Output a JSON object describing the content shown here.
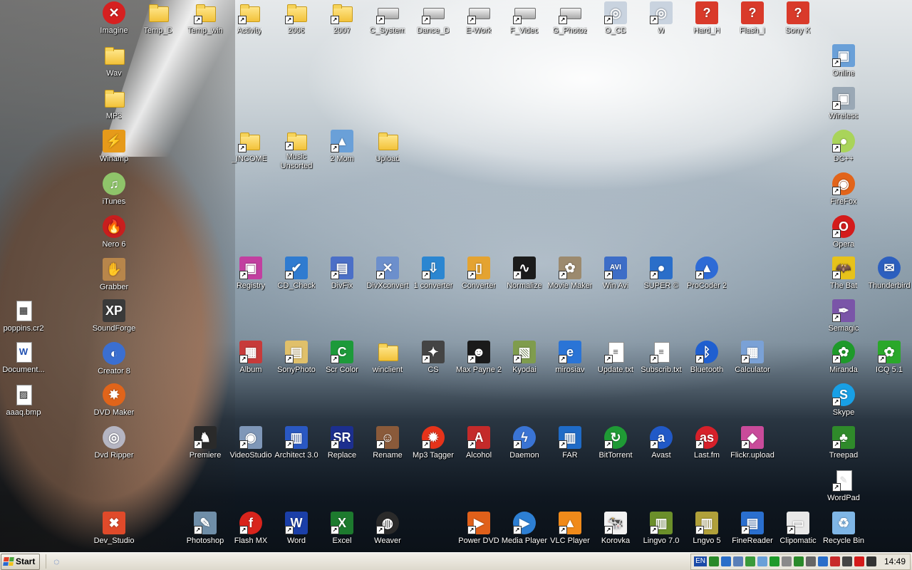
{
  "desktop": {
    "icons": [
      {
        "label": "Imagine",
        "glyph": "✕",
        "color": "#d62020",
        "kind": "circle",
        "shortcut": false
      },
      {
        "label": "Temp_D",
        "glyph": "",
        "color": "#f2c23a",
        "kind": "folder",
        "shortcut": false
      },
      {
        "label": "Temp_win",
        "glyph": "",
        "color": "#f2c23a",
        "kind": "folder",
        "shortcut": true
      },
      {
        "label": "Activity",
        "glyph": "",
        "color": "#f2c23a",
        "kind": "folder",
        "shortcut": true
      },
      {
        "label": "2006",
        "glyph": "",
        "color": "#f2c23a",
        "kind": "folder",
        "shortcut": true
      },
      {
        "label": "2007",
        "glyph": "",
        "color": "#f2c23a",
        "kind": "folder",
        "shortcut": true
      },
      {
        "label": "C_System",
        "glyph": "",
        "color": "#a9a9a9",
        "kind": "drive",
        "shortcut": true
      },
      {
        "label": "Dance_D",
        "glyph": "",
        "color": "#a9a9a9",
        "kind": "drive",
        "shortcut": true
      },
      {
        "label": "E-Work",
        "glyph": "",
        "color": "#a9a9a9",
        "kind": "drive",
        "shortcut": true
      },
      {
        "label": "F_Video",
        "glyph": "",
        "color": "#a9a9a9",
        "kind": "drive",
        "shortcut": true
      },
      {
        "label": "G_Photoz",
        "glyph": "",
        "color": "#a9a9a9",
        "kind": "drive",
        "shortcut": true
      },
      {
        "label": "O_CD",
        "glyph": "◎",
        "color": "#c9d3df",
        "kind": "box",
        "shortcut": true
      },
      {
        "label": "W",
        "glyph": "◎",
        "color": "#c9d3df",
        "kind": "box",
        "shortcut": true
      },
      {
        "label": "Hard_H",
        "glyph": "?",
        "color": "#d93a2a",
        "kind": "box",
        "shortcut": false
      },
      {
        "label": "Flash_I",
        "glyph": "?",
        "color": "#d93a2a",
        "kind": "box",
        "shortcut": false
      },
      {
        "label": "Sony K",
        "glyph": "?",
        "color": "#d93a2a",
        "kind": "box",
        "shortcut": false
      },
      {
        "label": "Wav",
        "glyph": "",
        "color": "#f2c23a",
        "kind": "folder",
        "shortcut": false
      },
      {
        "label": "MP3",
        "glyph": "",
        "color": "#f2c23a",
        "kind": "folder",
        "shortcut": false
      },
      {
        "label": "Winamp",
        "glyph": "⚡",
        "color": "#e69a1a",
        "kind": "box",
        "shortcut": false
      },
      {
        "label": "iTunes",
        "glyph": "♫",
        "color": "#8fc46a",
        "kind": "circle",
        "shortcut": false
      },
      {
        "label": "Nero 6",
        "glyph": "🔥",
        "color": "#c81e1e",
        "kind": "circle",
        "shortcut": false
      },
      {
        "label": "Grabber",
        "glyph": "✋",
        "color": "#b8864b",
        "kind": "box",
        "shortcut": false
      },
      {
        "label": "SoundForge",
        "glyph": "XP",
        "color": "#3a3a3a",
        "kind": "box",
        "shortcut": false
      },
      {
        "label": "Creator 8",
        "glyph": "◐",
        "color": "#3b6fd1",
        "kind": "circle",
        "shortcut": false
      },
      {
        "label": "DVD Maker",
        "glyph": "✸",
        "color": "#e0641a",
        "kind": "circle",
        "shortcut": false
      },
      {
        "label": "Dvd Ripper",
        "glyph": "◎",
        "color": "#b5b5c2",
        "kind": "circle",
        "shortcut": false
      },
      {
        "label": "Dev_Studio",
        "glyph": "✖",
        "color": "#e04a2a",
        "kind": "box",
        "shortcut": false
      },
      {
        "label": "poppins.cr2",
        "glyph": "▦",
        "color": "#ffffff",
        "kind": "doc",
        "shortcut": false
      },
      {
        "label": "Document...",
        "glyph": "W",
        "color": "#1f4fb0",
        "kind": "doc",
        "shortcut": false
      },
      {
        "label": "aaaq.bmp",
        "glyph": "▨",
        "color": "#ffffff",
        "kind": "doc",
        "shortcut": false
      },
      {
        "label": "_INCOME",
        "glyph": "",
        "color": "#f2c23a",
        "kind": "folder",
        "shortcut": true
      },
      {
        "label": "Music Unsorted",
        "glyph": "",
        "color": "#f2c23a",
        "kind": "folder",
        "shortcut": true
      },
      {
        "label": "2 Mom",
        "glyph": "▲",
        "color": "#6aa0d8",
        "kind": "box",
        "shortcut": true
      },
      {
        "label": "Upload",
        "glyph": "",
        "color": "#f2c23a",
        "kind": "folder",
        "shortcut": false
      },
      {
        "label": "Registry",
        "glyph": "▣",
        "color": "#c23fa0",
        "kind": "box",
        "shortcut": true
      },
      {
        "label": "CD_Check",
        "glyph": "✔",
        "color": "#2f7bd0",
        "kind": "box",
        "shortcut": true
      },
      {
        "label": "DivFix",
        "glyph": "▤",
        "color": "#4b6fc7",
        "kind": "box",
        "shortcut": true
      },
      {
        "label": "DivXconvert",
        "glyph": "✕",
        "color": "#6c8fcc",
        "kind": "box",
        "shortcut": true
      },
      {
        "label": "1 converter",
        "glyph": "⇩",
        "color": "#2b86d1",
        "kind": "box",
        "shortcut": true
      },
      {
        "label": "Converter",
        "glyph": "▯",
        "color": "#e4a331",
        "kind": "box",
        "shortcut": true
      },
      {
        "label": "Normalize",
        "glyph": "∿",
        "color": "#1b1b1b",
        "kind": "box",
        "shortcut": true
      },
      {
        "label": "Movie Maker",
        "glyph": "✿",
        "color": "#9c8a6e",
        "kind": "box",
        "shortcut": true
      },
      {
        "label": "Win Avi",
        "glyph": "AVI",
        "color": "#3d6dc7",
        "kind": "box",
        "shortcut": true
      },
      {
        "label": "SUPER ©",
        "glyph": "●",
        "color": "#2a6ec9",
        "kind": "box",
        "shortcut": true
      },
      {
        "label": "ProCoder 2",
        "glyph": "▲",
        "color": "#2e6bd6",
        "kind": "circle",
        "shortcut": true
      },
      {
        "label": "Album",
        "glyph": "▦",
        "color": "#c73a3a",
        "kind": "box",
        "shortcut": true
      },
      {
        "label": "SonyPhoto",
        "glyph": "▤",
        "color": "#e0c06a",
        "kind": "box",
        "shortcut": true
      },
      {
        "label": "Scr Color",
        "glyph": "C",
        "color": "#1d9a3a",
        "kind": "box",
        "shortcut": true
      },
      {
        "label": "winclient",
        "glyph": "",
        "color": "#f2c23a",
        "kind": "folder",
        "shortcut": false
      },
      {
        "label": "CS",
        "glyph": "✦",
        "color": "#444",
        "kind": "box",
        "shortcut": true
      },
      {
        "label": "Max Payne 2",
        "glyph": "☻",
        "color": "#1a1a1a",
        "kind": "box",
        "shortcut": true
      },
      {
        "label": "Kyodai",
        "glyph": "▧",
        "color": "#7f9c4d",
        "kind": "box",
        "shortcut": true
      },
      {
        "label": "mirosiav",
        "glyph": "e",
        "color": "#2a74d6",
        "kind": "box",
        "shortcut": true
      },
      {
        "label": "Update.txt",
        "glyph": "≡",
        "color": "#ffffff",
        "kind": "doc",
        "shortcut": true
      },
      {
        "label": "Subscrib.txt",
        "glyph": "≡",
        "color": "#ffffff",
        "kind": "doc",
        "shortcut": true
      },
      {
        "label": "Bluetooth",
        "glyph": "ᛒ",
        "color": "#1f5fd0",
        "kind": "circle",
        "shortcut": true
      },
      {
        "label": "Calculator",
        "glyph": "▦",
        "color": "#7aa1d6",
        "kind": "box",
        "shortcut": true
      },
      {
        "label": "Premiere",
        "glyph": "♞",
        "color": "#2a2a2a",
        "kind": "box",
        "shortcut": true
      },
      {
        "label": "VideoStudio",
        "glyph": "◉",
        "color": "#7f97b8",
        "kind": "box",
        "shortcut": true
      },
      {
        "label": "Architect 3.0",
        "glyph": "▥",
        "color": "#2a58c2",
        "kind": "box",
        "shortcut": true
      },
      {
        "label": "Replace",
        "glyph": "SR",
        "color": "#1c2f8f",
        "kind": "box",
        "shortcut": true
      },
      {
        "label": "Rename",
        "glyph": "☺",
        "color": "#8a5a3a",
        "kind": "box",
        "shortcut": true
      },
      {
        "label": "Mp3 Tagger",
        "glyph": "✹",
        "color": "#e6331a",
        "kind": "circle",
        "shortcut": true
      },
      {
        "label": "Alcohol",
        "glyph": "A",
        "color": "#c42a2a",
        "kind": "box",
        "shortcut": true
      },
      {
        "label": "Daemon",
        "glyph": "ϟ",
        "color": "#3a74d4",
        "kind": "circle",
        "shortcut": true
      },
      {
        "label": "FAR",
        "glyph": "▥",
        "color": "#1f6bc7",
        "kind": "box",
        "shortcut": true
      },
      {
        "label": "BitTorrent",
        "glyph": "↻",
        "color": "#1f9a35",
        "kind": "circle",
        "shortcut": true
      },
      {
        "label": "Avast",
        "glyph": "a",
        "color": "#2159c7",
        "kind": "circle",
        "shortcut": true
      },
      {
        "label": "Last.fm",
        "glyph": "as",
        "color": "#d6202a",
        "kind": "circle",
        "shortcut": true
      },
      {
        "label": "Flickr.upload",
        "glyph": "◆",
        "color": "#c94b9a",
        "kind": "box",
        "shortcut": true
      },
      {
        "label": "Photoshop",
        "glyph": "✎",
        "color": "#6f8ea8",
        "kind": "box",
        "shortcut": true
      },
      {
        "label": "Flash MX",
        "glyph": "f",
        "color": "#d8241c",
        "kind": "circle",
        "shortcut": true
      },
      {
        "label": "Word",
        "glyph": "W",
        "color": "#1b3fa8",
        "kind": "box",
        "shortcut": true
      },
      {
        "label": "Excel",
        "glyph": "X",
        "color": "#1d7a2e",
        "kind": "box",
        "shortcut": true
      },
      {
        "label": "Weaver",
        "glyph": "◍",
        "color": "#2a2a2a",
        "kind": "circle",
        "shortcut": true
      },
      {
        "label": "Power DVD",
        "glyph": "▶",
        "color": "#e0601a",
        "kind": "box",
        "shortcut": true
      },
      {
        "label": "Media Player",
        "glyph": "▶",
        "color": "#2d7fd3",
        "kind": "circle",
        "shortcut": true
      },
      {
        "label": "VLC Player",
        "glyph": "▲",
        "color": "#f08a1a",
        "kind": "box",
        "shortcut": true
      },
      {
        "label": "Korovka",
        "glyph": "🐄",
        "color": "#f2f2f2",
        "kind": "box",
        "shortcut": true
      },
      {
        "label": "Lingvo 7.0",
        "glyph": "▥",
        "color": "#6b8f2a",
        "kind": "box",
        "shortcut": true
      },
      {
        "label": "Lngvo 5",
        "glyph": "▥",
        "color": "#b0a03a",
        "kind": "box",
        "shortcut": true
      },
      {
        "label": "FineReader",
        "glyph": "▤",
        "color": "#2a6fcf",
        "kind": "box",
        "shortcut": true
      },
      {
        "label": "Clipomatic",
        "glyph": "▭",
        "color": "#e8e8e8",
        "kind": "box",
        "shortcut": true
      },
      {
        "label": "Recycle Bin",
        "glyph": "♻",
        "color": "#7fb6e6",
        "kind": "box",
        "shortcut": false
      },
      {
        "label": "Online",
        "glyph": "▣",
        "color": "#6aa0d8",
        "kind": "box",
        "shortcut": true
      },
      {
        "label": "Wireless",
        "glyph": "▣",
        "color": "#9aa8b5",
        "kind": "box",
        "shortcut": true
      },
      {
        "label": "DC++",
        "glyph": "●",
        "color": "#a9d45a",
        "kind": "circle",
        "shortcut": true
      },
      {
        "label": "FireFox",
        "glyph": "◉",
        "color": "#e2641a",
        "kind": "circle",
        "shortcut": true
      },
      {
        "label": "Opera",
        "glyph": "O",
        "color": "#d41b1b",
        "kind": "circle",
        "shortcut": true
      },
      {
        "label": "The Bat",
        "glyph": "🦇",
        "color": "#e7c21a",
        "kind": "box",
        "shortcut": true
      },
      {
        "label": "Thunderbird",
        "glyph": "✉",
        "color": "#2c5fbf",
        "kind": "circle",
        "shortcut": false
      },
      {
        "label": "Semagic",
        "glyph": "✒",
        "color": "#7a55a8",
        "kind": "box",
        "shortcut": true
      },
      {
        "label": "Miranda",
        "glyph": "✿",
        "color": "#1e9a2a",
        "kind": "circle",
        "shortcut": true
      },
      {
        "label": "ICQ 5.1",
        "glyph": "✿",
        "color": "#2aa82a",
        "kind": "box",
        "shortcut": true
      },
      {
        "label": "Skype",
        "glyph": "S",
        "color": "#18a0e6",
        "kind": "circle",
        "shortcut": true
      },
      {
        "label": "Treepad",
        "glyph": "♣",
        "color": "#2f8a2a",
        "kind": "box",
        "shortcut": true
      },
      {
        "label": "WordPad",
        "glyph": "✎",
        "color": "#e4e4e4",
        "kind": "doc",
        "shortcut": true
      }
    ]
  },
  "taskbar": {
    "start_label": "Start",
    "quick_launch_glyph": "◌",
    "tray_language": "EN",
    "tray_icons": [
      "#2a8a2a",
      "#2a6ec9",
      "#5a7fb8",
      "#3a9a3a",
      "#6aa0d8",
      "#1e9a2a",
      "#8a8a8a",
      "#2a8a2a",
      "#666666",
      "#2a6ec9",
      "#c82a2a",
      "#444444",
      "#d41b1b",
      "#333333"
    ],
    "clock": "14:49"
  }
}
